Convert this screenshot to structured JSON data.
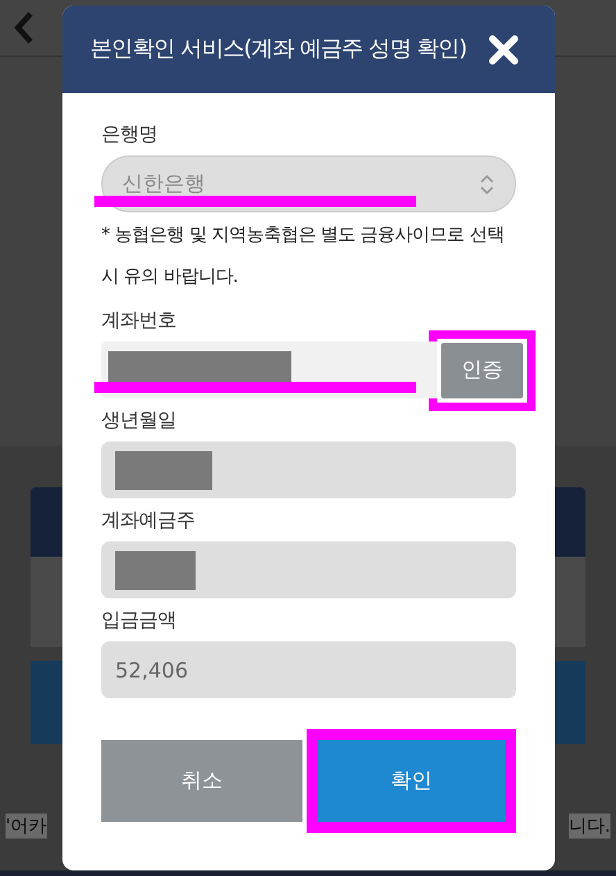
{
  "background": {
    "footer_texts": [
      "'어카",
      "니다."
    ]
  },
  "dialog": {
    "title": "본인확인 서비스(계좌 예금주 성명 확인)",
    "fields": [
      {
        "kind": "select",
        "label": "은행명",
        "value": "신한은행",
        "underlined": true
      },
      {
        "kind": "note",
        "text": "* 농협은행 및 지역농축협은 별도 금융사이므로 선택 시 유의 바랍니다."
      },
      {
        "kind": "account",
        "label": "계좌번호",
        "redacted": true,
        "underlined": true,
        "button": {
          "label": "인증",
          "framed": true
        }
      },
      {
        "kind": "text",
        "label": "생년월일",
        "redacted": true
      },
      {
        "kind": "text",
        "label": "계좌예금주",
        "redacted": true
      },
      {
        "kind": "text",
        "label": "입금금액",
        "value": "52,406"
      }
    ],
    "actions": [
      {
        "kind": "cancel",
        "label": "취소",
        "framed": false
      },
      {
        "kind": "confirm",
        "label": "확인",
        "framed": true
      }
    ]
  }
}
